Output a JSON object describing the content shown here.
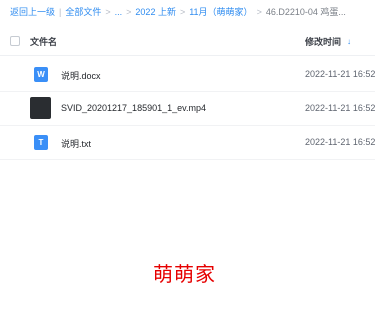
{
  "breadcrumb": {
    "items": [
      {
        "label": "返回上一级"
      },
      {
        "label": "全部文件"
      },
      {
        "label": "..."
      },
      {
        "label": "2022 上新"
      },
      {
        "label": "11月（萌萌家）"
      },
      {
        "label": "46.D2210-04 鸡蛋..."
      }
    ],
    "divider": "|",
    "arrow": ">"
  },
  "header": {
    "name_label": "文件名",
    "time_label": "修改时间",
    "sort_icon": "arrow-down-icon"
  },
  "files": [
    {
      "name": "说明.docx",
      "modified": "2022-11-21 16:52",
      "icon": "word-doc-icon",
      "icon_glyph": "W"
    },
    {
      "name": "SVID_20201217_185901_1_ev.mp4",
      "modified": "2022-11-21 16:52",
      "icon": "video-thumbnail-icon",
      "icon_glyph": ""
    },
    {
      "name": "说明.txt",
      "modified": "2022-11-21 16:52",
      "icon": "txt-doc-icon",
      "icon_glyph": "T"
    }
  ],
  "watermark": "萌萌家",
  "colors": {
    "link": "#2f8cf0",
    "watermark": "#e60000",
    "doc_icon": "#3a8ff7"
  }
}
